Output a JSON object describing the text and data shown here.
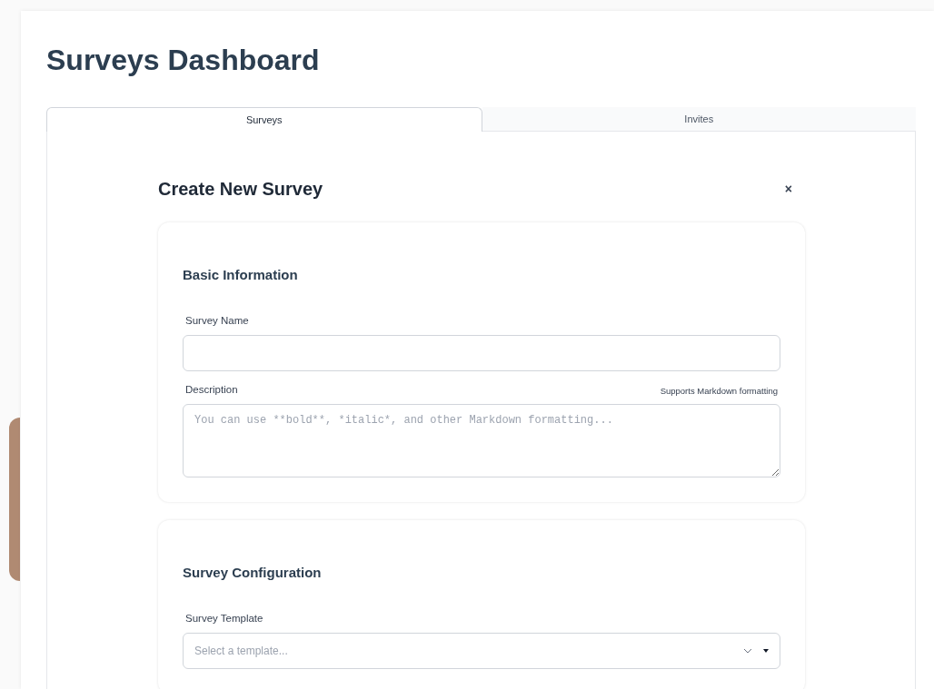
{
  "page": {
    "title": "Surveys Dashboard"
  },
  "tabs": [
    {
      "label": "Surveys",
      "selected": true
    },
    {
      "label": "Invites",
      "selected": false
    }
  ],
  "modal": {
    "title": "Create New Survey",
    "close": "×",
    "sections": [
      {
        "title": "Basic Information",
        "fields": [
          {
            "kind": "text",
            "label": "Survey Name"
          },
          {
            "kind": "textarea",
            "label": "Description",
            "hint": "Supports Markdown formatting",
            "placeholder": "You can use **bold**, *italic*, and other Markdown formatting..."
          }
        ]
      },
      {
        "title": "Survey Configuration",
        "fields": [
          {
            "kind": "select",
            "label": "Survey Template",
            "placeholder": "Select a template..."
          }
        ]
      }
    ]
  }
}
